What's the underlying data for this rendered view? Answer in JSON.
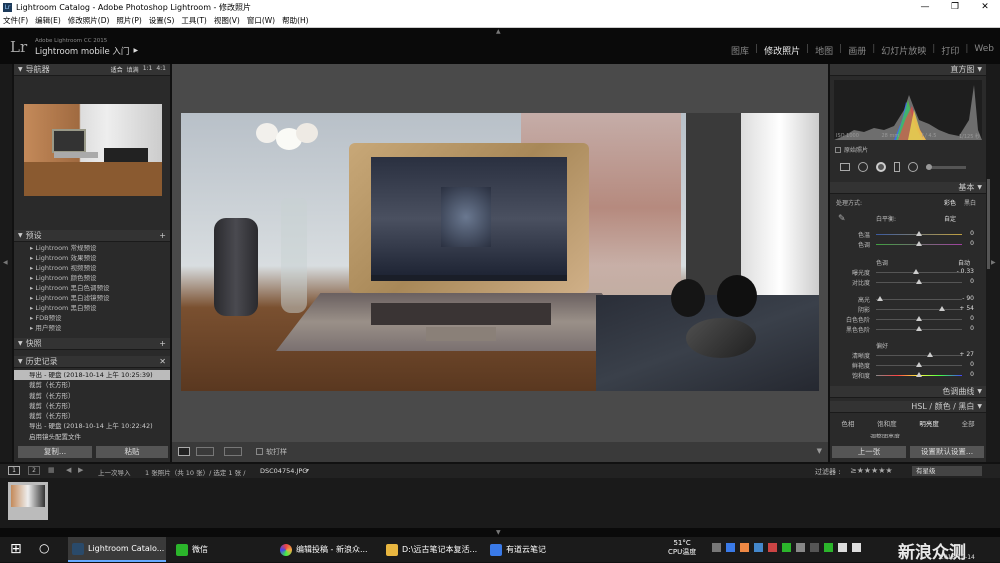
{
  "window": {
    "title": "Lightroom Catalog - Adobe Photoshop Lightroom - 修改照片",
    "app_icon": "Lr",
    "minimize": "—",
    "maximize": "❐",
    "close": "✕"
  },
  "menu": [
    "文件(F)",
    "编辑(E)",
    "修改照片(D)",
    "照片(P)",
    "设置(S)",
    "工具(T)",
    "视图(V)",
    "窗口(W)",
    "帮助(H)"
  ],
  "identity": {
    "logo": "Lr",
    "cc_label": "Adobe Lightroom CC 2015",
    "mobile_label": "Lightroom mobile 入门"
  },
  "modules": [
    "图库",
    "修改照片",
    "地图",
    "画册",
    "幻灯片放映",
    "打印",
    "Web"
  ],
  "modules_separator": "|",
  "active_module": "修改照片",
  "navigator": {
    "title": "导航器",
    "zoom_options": [
      "适合",
      "填满",
      "1:1",
      "4:1"
    ]
  },
  "presets": {
    "title": "预设",
    "add": "+",
    "items": [
      "Lightroom 常规预设",
      "Lightroom 效果预设",
      "Lightroom 视频预设",
      "Lightroom 颜色预设",
      "Lightroom 黑白色调预设",
      "Lightroom 黑白滤镜预设",
      "Lightroom 黑白预设",
      "FDB预设",
      "用户预设"
    ]
  },
  "snapshots": {
    "title": "快照",
    "add": "+"
  },
  "history": {
    "title": "历史记录",
    "close": "✕",
    "items": [
      "导出 - 硬盘 (2018-10-14 上午 10:25:39)",
      "裁剪（长方形）",
      "裁剪（长方形）",
      "裁剪（长方形）",
      "裁剪（长方形）",
      "导出 - 硬盘 (2018-10-14 上午 10:22:42)",
      "启用镜头配置文件"
    ]
  },
  "left_buttons": {
    "copy": "复制...",
    "paste": "粘贴"
  },
  "toolbar": {
    "soft_proof": "软打样"
  },
  "histogram": {
    "title": "直方图",
    "info": [
      "ISO 1000",
      "28 mm",
      "f / 4.5",
      "1/125 秒"
    ],
    "original_photo": "原始照片"
  },
  "basic": {
    "title": "基本",
    "treatment_label": "处理方式:",
    "color": "彩色",
    "bw": "黑白",
    "wb_label": "白平衡:",
    "wb_value": "自定",
    "tone_label": "色调",
    "auto": "自动",
    "presence_label": "偏好",
    "sliders": [
      {
        "label": "色温",
        "value": "0",
        "pos": 0.5
      },
      {
        "label": "色调",
        "value": "0",
        "pos": 0.5
      },
      {
        "label": "曝光度",
        "value": "- 0.33",
        "pos": 0.47
      },
      {
        "label": "对比度",
        "value": "0",
        "pos": 0.5
      },
      {
        "label": "高光",
        "value": "- 90",
        "pos": 0.05
      },
      {
        "label": "阴影",
        "value": "+ 54",
        "pos": 0.77
      },
      {
        "label": "白色色阶",
        "value": "0",
        "pos": 0.5
      },
      {
        "label": "黑色色阶",
        "value": "0",
        "pos": 0.5
      },
      {
        "label": "清晰度",
        "value": "+ 27",
        "pos": 0.63
      },
      {
        "label": "鲜艳度",
        "value": "0",
        "pos": 0.5
      },
      {
        "label": "饱和度",
        "value": "0",
        "pos": 0.5
      }
    ]
  },
  "tone_curve": {
    "title": "色调曲线"
  },
  "hsl": {
    "title": "HSL / 颜色 / 黑白",
    "tabs": [
      "色相",
      "饱和度",
      "明亮度",
      "全部"
    ],
    "adjust": "调整明亮度"
  },
  "right_buttons": {
    "prev": "上一张",
    "reset": "设置默认设置..."
  },
  "filmbar": {
    "pages": [
      "1",
      "2"
    ],
    "source": "上一次导入",
    "count": "1 张照片（共 10 张）/ 选定 1 张 /",
    "filename": "DSC04754.JPG",
    "filter_label": "过滤器 :",
    "filter_value": "有星级"
  },
  "taskbar": {
    "items": [
      {
        "label": "Lightroom Catalo...",
        "color": "#2a4a6a"
      },
      {
        "label": "微信",
        "color": "#2bb52b"
      },
      {
        "label": "编辑投稿 - 新浪众...",
        "color": "#e84"
      },
      {
        "label": "D:\\远古笔记本复活...",
        "color": "#e8b640"
      },
      {
        "label": "有道云笔记",
        "color": "#3a7ae8"
      }
    ],
    "temp": "51°C",
    "temp_label": "CPU温度",
    "watermark": "新浪众测",
    "date": "2018-10-14"
  },
  "colors": {
    "panel_bg": "#2a2a2a",
    "center_bg": "#4a4a4a",
    "titlebar_bg": "#ffffff",
    "identity_bg": "#0a0a0a"
  }
}
